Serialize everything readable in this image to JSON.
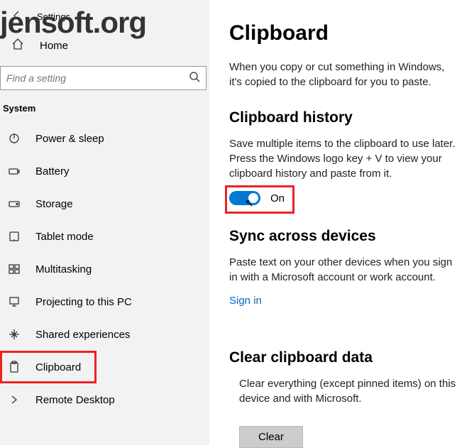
{
  "watermark": "jensoft.org",
  "header": {
    "settings_label": "Settings",
    "home_label": "Home"
  },
  "search": {
    "placeholder": "Find a setting"
  },
  "sidebar": {
    "category": "System",
    "items": [
      {
        "icon": "power",
        "label": "Power & sleep"
      },
      {
        "icon": "battery",
        "label": "Battery"
      },
      {
        "icon": "storage",
        "label": "Storage"
      },
      {
        "icon": "tablet",
        "label": "Tablet mode"
      },
      {
        "icon": "multitask",
        "label": "Multitasking"
      },
      {
        "icon": "project",
        "label": "Projecting to this PC"
      },
      {
        "icon": "shared",
        "label": "Shared experiences"
      },
      {
        "icon": "clipboard",
        "label": "Clipboard",
        "selected": true
      },
      {
        "icon": "remote",
        "label": "Remote Desktop"
      }
    ]
  },
  "main": {
    "title": "Clipboard",
    "intro": "When you copy or cut something in Windows, it's copied to the clipboard for you to paste.",
    "history": {
      "heading": "Clipboard history",
      "desc": "Save multiple items to the clipboard to use later. Press the Windows logo key + V to view your clipboard history and paste from it.",
      "toggle_state": "On"
    },
    "sync": {
      "heading": "Sync across devices",
      "desc": "Paste text on your other devices when you sign in with a Microsoft account or work account.",
      "signin": "Sign in"
    },
    "clear": {
      "heading": "Clear clipboard data",
      "desc": "Clear everything (except pinned items) on this device and with Microsoft.",
      "button": "Clear"
    }
  }
}
